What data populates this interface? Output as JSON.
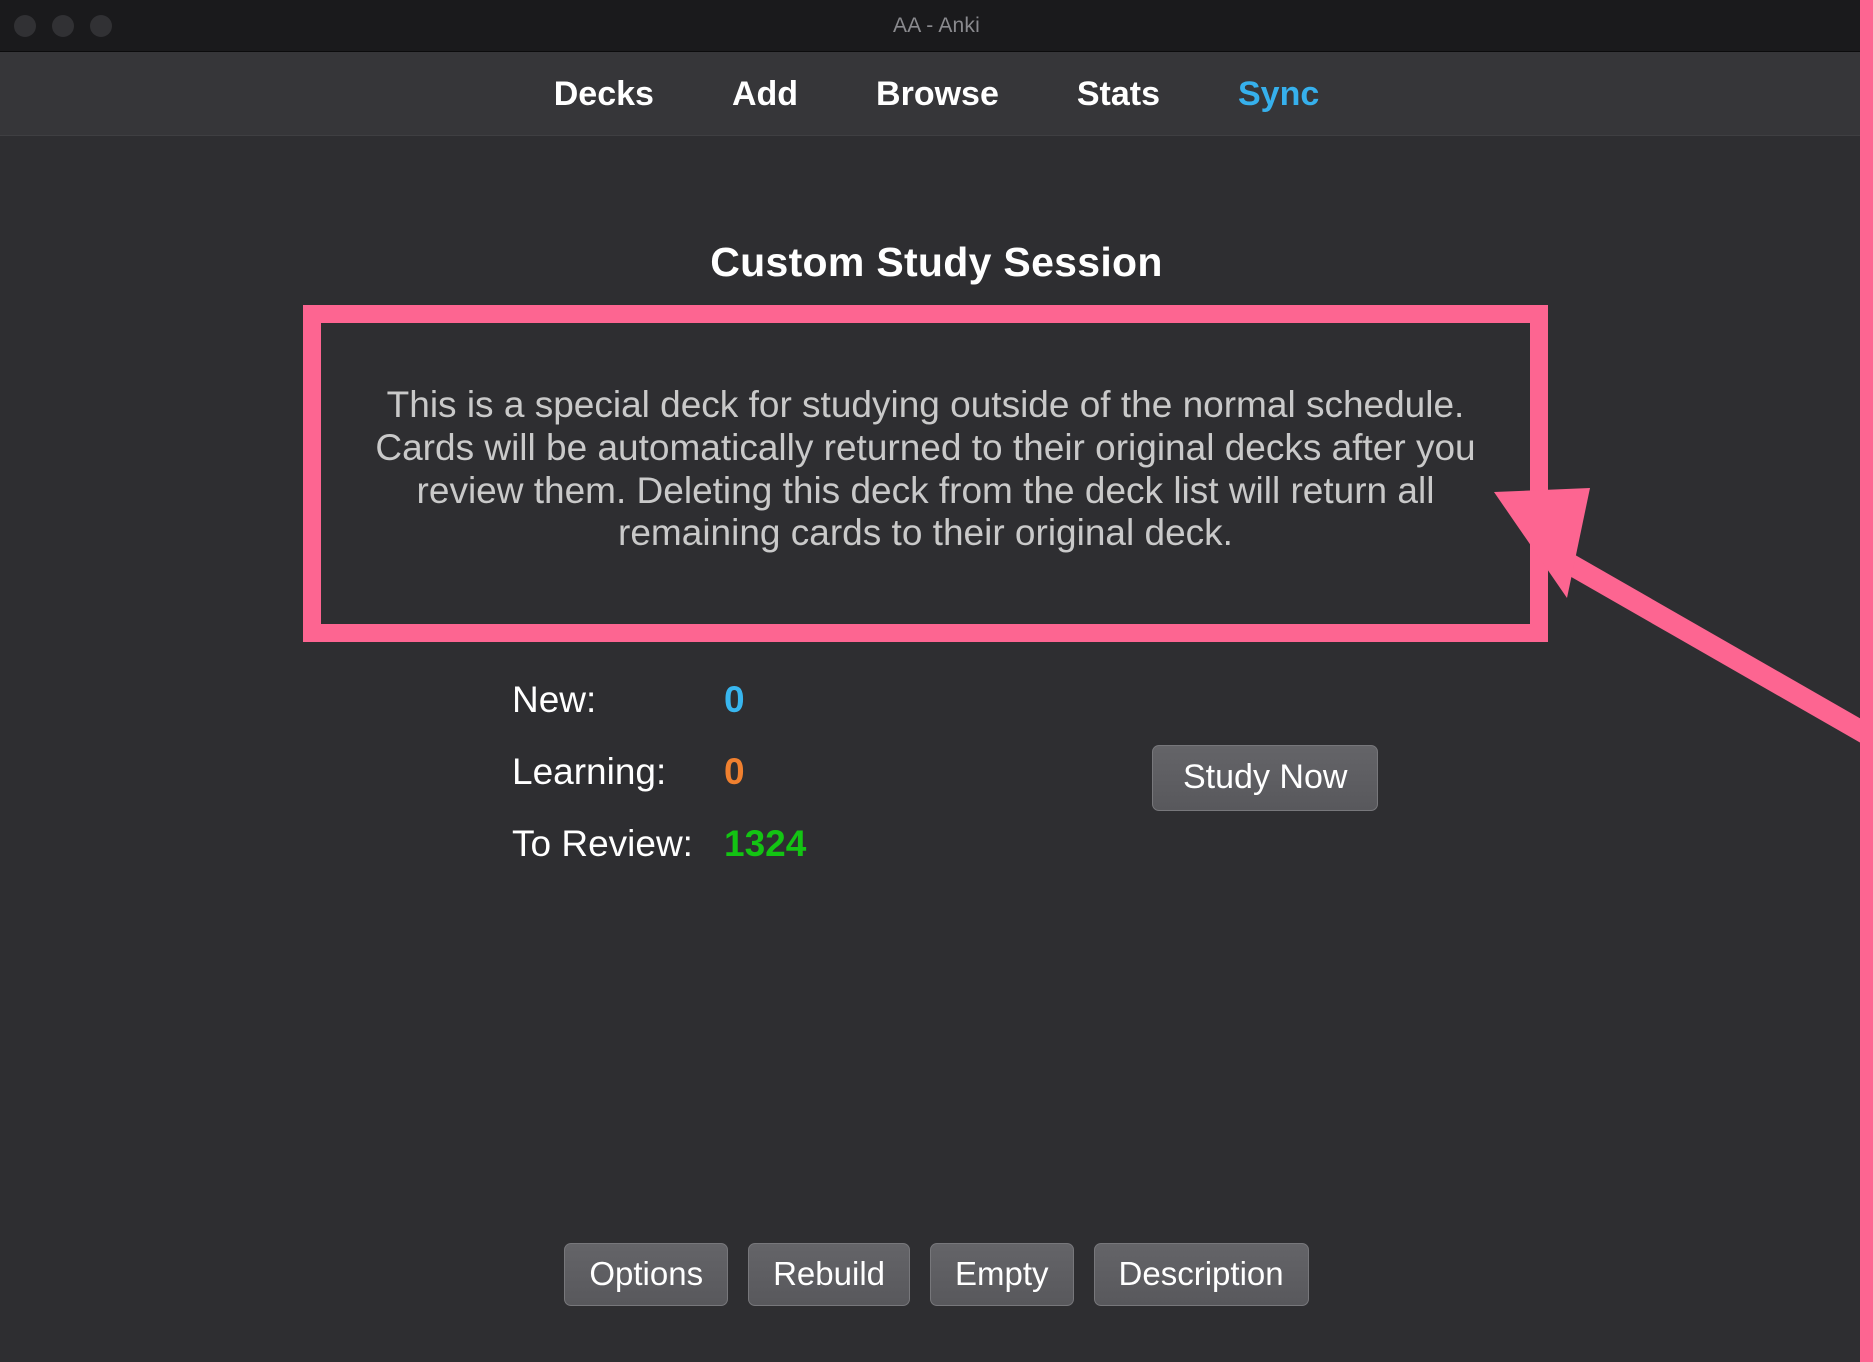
{
  "window": {
    "title": "AA - Anki",
    "traffic_lights": [
      "close",
      "minimize",
      "maximize"
    ]
  },
  "navbar": {
    "items": [
      {
        "label": "Decks",
        "accent": false
      },
      {
        "label": "Add",
        "accent": false
      },
      {
        "label": "Browse",
        "accent": false
      },
      {
        "label": "Stats",
        "accent": false
      },
      {
        "label": "Sync",
        "accent": true
      }
    ]
  },
  "main": {
    "page_title": "Custom Study Session",
    "description": "This is a special deck for studying outside of the normal schedule. Cards will be automatically returned to their original decks after you review them. Deleting this deck from the deck list will return all remaining cards to their original deck.",
    "stats": [
      {
        "label": "New:",
        "value": "0",
        "color": "#38b6ef"
      },
      {
        "label": "Learning:",
        "value": "0",
        "color": "#f0802f"
      },
      {
        "label": "To Review:",
        "value": "1324",
        "color": "#13c413"
      }
    ],
    "study_now_label": "Study Now",
    "bottom_buttons": [
      {
        "label": "Options"
      },
      {
        "label": "Rebuild"
      },
      {
        "label": "Empty"
      },
      {
        "label": "Description"
      }
    ]
  },
  "annotation": {
    "highlight_color": "#fd6591",
    "target": "description-box",
    "arrow": "points-up-left-to-description-box"
  },
  "colors": {
    "background": "#2e2e31",
    "titlebar": "#1a1a1c",
    "navbar": "#363639",
    "accent_link": "#36b0ec",
    "highlight": "#fd6591",
    "description_text": "#c9c9c9"
  }
}
